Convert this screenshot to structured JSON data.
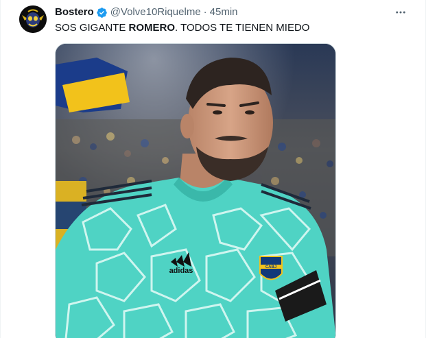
{
  "tweet": {
    "display_name": "Bostero",
    "handle": "@Volve10Riquelme",
    "separator": "·",
    "time": "45min",
    "text_before": "SOS GIGANTE ",
    "text_bold": "ROMERO",
    "text_after": ". TODOS TE TIENEN MIEDO",
    "verified": true,
    "media": {
      "jersey_brand": "adidas",
      "crest_text": "CABJ"
    }
  },
  "colors": {
    "verified": "#1d9bf0",
    "text": "#0f1419",
    "secondary": "#536471",
    "jersey": "#4fd3c4",
    "boca_blue": "#123a7a",
    "boca_gold": "#f2c21b"
  },
  "icons": {
    "avatar": "skull-avatar-icon",
    "verified": "verified-badge-icon",
    "more": "more-horizontal-icon"
  }
}
